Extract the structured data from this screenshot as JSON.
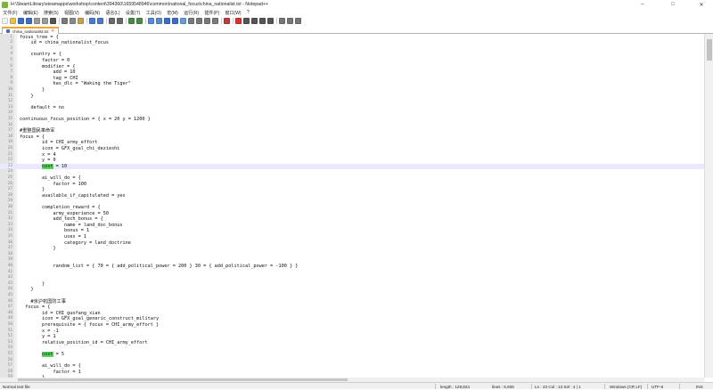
{
  "window": {
    "title": "H:\\SteamLibrary\\steamapps\\workshop\\content\\394360\\1659548946\\common\\national_focus\\china_nationalist.txt - Notepad++",
    "minimize": "–",
    "maximize": "□",
    "close": "✕"
  },
  "menu": [
    "文件(F)",
    "编辑(E)",
    "搜索(S)",
    "视图(V)",
    "编码(N)",
    "语言(L)",
    "设置(T)",
    "工具(O)",
    "宏(M)",
    "运行(R)",
    "插件(P)",
    "窗口(W)",
    "?"
  ],
  "toolbar": {
    "icons": [
      {
        "name": "new-file-icon",
        "color": "#f2f2f2"
      },
      {
        "name": "open-file-icon",
        "color": "#e8c04a"
      },
      {
        "name": "save-icon",
        "color": "#3a6fc6"
      },
      {
        "name": "save-all-icon",
        "color": "#3a6fc6"
      },
      {
        "name": "close-file-icon",
        "color": "#9a9a9a"
      },
      {
        "name": "close-all-icon",
        "color": "#9a9a9a"
      },
      {
        "name": "print-icon",
        "color": "#555555"
      },
      {
        "sep": true
      },
      {
        "name": "cut-icon",
        "color": "#7a7a7a"
      },
      {
        "name": "copy-icon",
        "color": "#8a8a8a"
      },
      {
        "name": "paste-icon",
        "color": "#c9a24a"
      },
      {
        "sep": true
      },
      {
        "name": "undo-icon",
        "color": "#4a7bd0"
      },
      {
        "name": "redo-icon",
        "color": "#4a7bd0"
      },
      {
        "sep": true
      },
      {
        "name": "find-icon",
        "color": "#6a6a6a"
      },
      {
        "name": "replace-icon",
        "color": "#6a6a6a"
      },
      {
        "sep": true
      },
      {
        "name": "zoom-in-icon",
        "color": "#4a8a4a"
      },
      {
        "name": "zoom-out-icon",
        "color": "#4a8a4a"
      },
      {
        "sep": true
      },
      {
        "name": "sync-vertical-icon",
        "color": "#5a8ad0"
      },
      {
        "name": "sync-horizontal-icon",
        "color": "#5a8ad0"
      },
      {
        "name": "word-wrap-icon",
        "color": "#3a6fc6"
      },
      {
        "name": "show-all-chars-icon",
        "color": "#3a6fc6"
      },
      {
        "name": "indent-guide-icon",
        "color": "#6a9ad8"
      },
      {
        "name": "user-language-icon",
        "color": "#7a7a7a"
      },
      {
        "name": "doc-map-icon",
        "color": "#7a7a7a"
      },
      {
        "name": "function-list-icon",
        "color": "#7a7a7a"
      },
      {
        "name": "folder-workspace-icon",
        "color": "#7a7a7a"
      },
      {
        "sep": true
      },
      {
        "name": "monitoring-icon",
        "color": "#c43a3a"
      },
      {
        "sep": true
      },
      {
        "name": "record-macro-icon",
        "color": "#d43434"
      },
      {
        "name": "stop-record-icon",
        "color": "#555555"
      },
      {
        "name": "playback-icon",
        "color": "#555555"
      },
      {
        "name": "run-macro-multiple-icon",
        "color": "#555555"
      },
      {
        "name": "save-macro-icon",
        "color": "#555555"
      },
      {
        "sep": true
      },
      {
        "name": "spell-check-icon",
        "color": "#777777"
      },
      {
        "name": "abc-icon",
        "color": "#777777"
      },
      {
        "name": "abc-next-icon",
        "color": "#777777"
      }
    ]
  },
  "tab": {
    "label": "china_nationalist.txt",
    "close": "✕"
  },
  "editor": {
    "first_line_number": 1,
    "current_line": 23,
    "lines": [
      "focus_tree = {",
      "    id = china_nationalist_focus",
      "",
      "    country = {",
      "        factor = 0",
      "        modifier = {",
      "            add = 10",
      "            tag = CHI",
      "            has_dlc = \"Waking the Tiger\"",
      "        }",
      "    }",
      "",
      "    default = no",
      "",
      "continuous_focus_position = { x = 20 y = 1200 }",
      "",
      "#重整国民革命军",
      "focus = {",
      "        id = CHI_army_effort",
      "        icon = GFX_goal_chi_dezieshi",
      "        x = 4",
      "        y = 0",
      "        cost = 10",
      "",
      "        ai_will_do = {",
      "            factor = 100",
      "        }",
      "        available_if_capitulated = yes",
      "",
      "        completion_reward = {",
      "            army_experience = 50",
      "            add_tech_bonus = {",
      "                name = land_doc_bonus",
      "                bonus = 1",
      "                uses = 1",
      "                category = land_doctrine",
      "            }",
      "",
      "",
      "            random_list = { 70 = { add_political_power = 200 } 30 = { add_political_power = -100 } }",
      "",
      "",
      "        }",
      "    }",
      "",
      "    #京沪杭国防工事",
      "  focus = {",
      "        id = CHI_guofang_xian",
      "        icon = GFX_goal_generic_construct_military",
      "        prerequisite = { focus = CHI_army_effort }",
      "        x = -1",
      "        y = 1",
      "        relative_position_id = CHI_army_effort",
      "",
      "        cost = 5",
      "",
      "        ai_will_do = {",
      "            factor = 1",
      "        }"
    ],
    "highlight_word": "cost",
    "highlight_lines": [
      23,
      55
    ]
  },
  "status": {
    "file_type": "Normal text file",
    "length": "length : 129,824",
    "lines": "lines : 6,936",
    "position": "Ln : 23    Col : 13    Sel : 4 | 1",
    "eol": "Windows (CR LF)",
    "encoding": "UTF-8",
    "insert_mode": "INS"
  }
}
